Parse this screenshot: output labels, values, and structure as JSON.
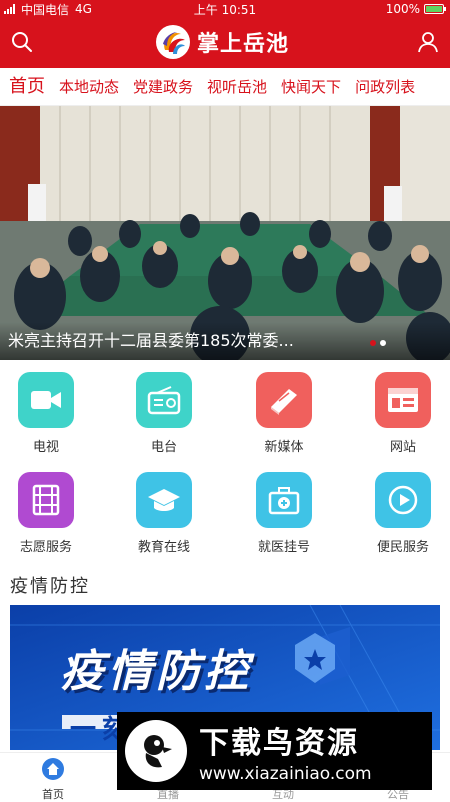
{
  "status": {
    "carrier": "中国电信",
    "network": "4G",
    "time": "上午 10:51",
    "battery_percent": "100%",
    "battery_level": 1.0
  },
  "header": {
    "app_title": "掌上岳池",
    "search_icon": "search-icon",
    "user_icon": "user-icon"
  },
  "tabs": [
    {
      "label": "首页",
      "active": true
    },
    {
      "label": "本地动态"
    },
    {
      "label": "党建政务"
    },
    {
      "label": "视听岳池"
    },
    {
      "label": "快闻天下"
    },
    {
      "label": "问政列表"
    }
  ],
  "banner": {
    "caption": "米亮主持召开十二届县委第185次常委...",
    "slides": 2,
    "active_slide": 0
  },
  "services": [
    {
      "label": "电视",
      "icon": "tv-icon",
      "color": "#3fd3c9"
    },
    {
      "label": "电台",
      "icon": "radio-icon",
      "color": "#3fd3c9"
    },
    {
      "label": "新媒体",
      "icon": "book-icon",
      "color": "#f0605d"
    },
    {
      "label": "网站",
      "icon": "website-icon",
      "color": "#f0605d"
    },
    {
      "label": "志愿服务",
      "icon": "film-icon",
      "color": "#b04ad1"
    },
    {
      "label": "教育在线",
      "icon": "graduation-cap-icon",
      "color": "#3fc3e6"
    },
    {
      "label": "就医挂号",
      "icon": "medical-kit-icon",
      "color": "#3fc3e6"
    },
    {
      "label": "便民服务",
      "icon": "play-icon",
      "color": "#3fc3e6"
    }
  ],
  "section": {
    "title": "疫情防控",
    "promo_text": "疫情防控",
    "promo_subtext": "一刻不得松懈"
  },
  "watermark": {
    "title": "下载鸟资源",
    "url": "www.xiazainiao.com"
  },
  "bottom_nav": [
    {
      "label": "首页",
      "icon": "home-icon",
      "active": true
    },
    {
      "label": "直播",
      "icon": "live-icon"
    },
    {
      "label": "互动",
      "icon": "interact-icon"
    },
    {
      "label": "公告",
      "icon": "notice-icon"
    }
  ],
  "colors": {
    "brand_red": "#d7121c",
    "teal": "#3fd3c9",
    "coral": "#f0605d",
    "purple": "#b04ad1",
    "sky": "#3fc3e6"
  }
}
